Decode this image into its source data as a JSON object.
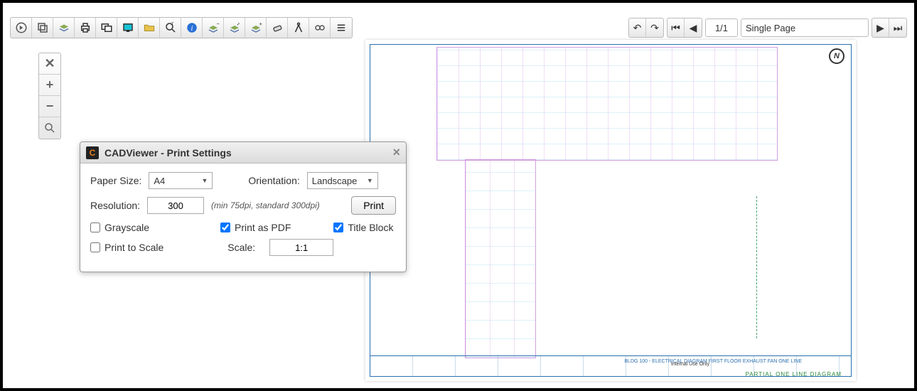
{
  "toolbar": {
    "left_icons": [
      "navigate-icon",
      "layers-icon",
      "layers2-icon",
      "print-icon",
      "window-icon",
      "screen-icon",
      "folder-icon",
      "zoom-text-icon",
      "info-icon",
      "stack1-icon",
      "stack2-icon",
      "stack3-icon",
      "eraser-icon",
      "compass-icon",
      "link-icon",
      "menu-icon"
    ]
  },
  "top_right": {
    "page_indicator": "1/1",
    "layout_select": "Single Page"
  },
  "zoom": {
    "tooltips": {
      "extents": "Extents",
      "in": "Zoom In",
      "out": "Zoom Out",
      "window": "Zoom Window"
    }
  },
  "dialog": {
    "title": "CADViewer - Print Settings",
    "paper_size_label": "Paper Size:",
    "paper_size_value": "A4",
    "orientation_label": "Orientation:",
    "orientation_value": "Landscape",
    "resolution_label": "Resolution:",
    "resolution_value": "300",
    "resolution_hint": "(min 75dpi, standard 300dpi)",
    "print_btn": "Print",
    "grayscale_label": "Grayscale",
    "print_as_pdf_label": "Print as PDF",
    "title_block_label": "Title Block",
    "print_to_scale_label": "Print to Scale",
    "scale_label": "Scale:",
    "scale_value": "1:1",
    "grayscale_checked": false,
    "print_as_pdf_checked": true,
    "title_block_checked": true,
    "print_to_scale_checked": false
  },
  "canvas": {
    "legend_label": "PARTIAL ONE LINE DIAGRAM",
    "titleblock_main": "BLDG 100 - ELECTRICAL DIAGRAM\nFIRST FLOOR\nEXHAUST FAN ONE LINE",
    "titleblock_internal": "Internal Use Only",
    "compass": "N"
  }
}
